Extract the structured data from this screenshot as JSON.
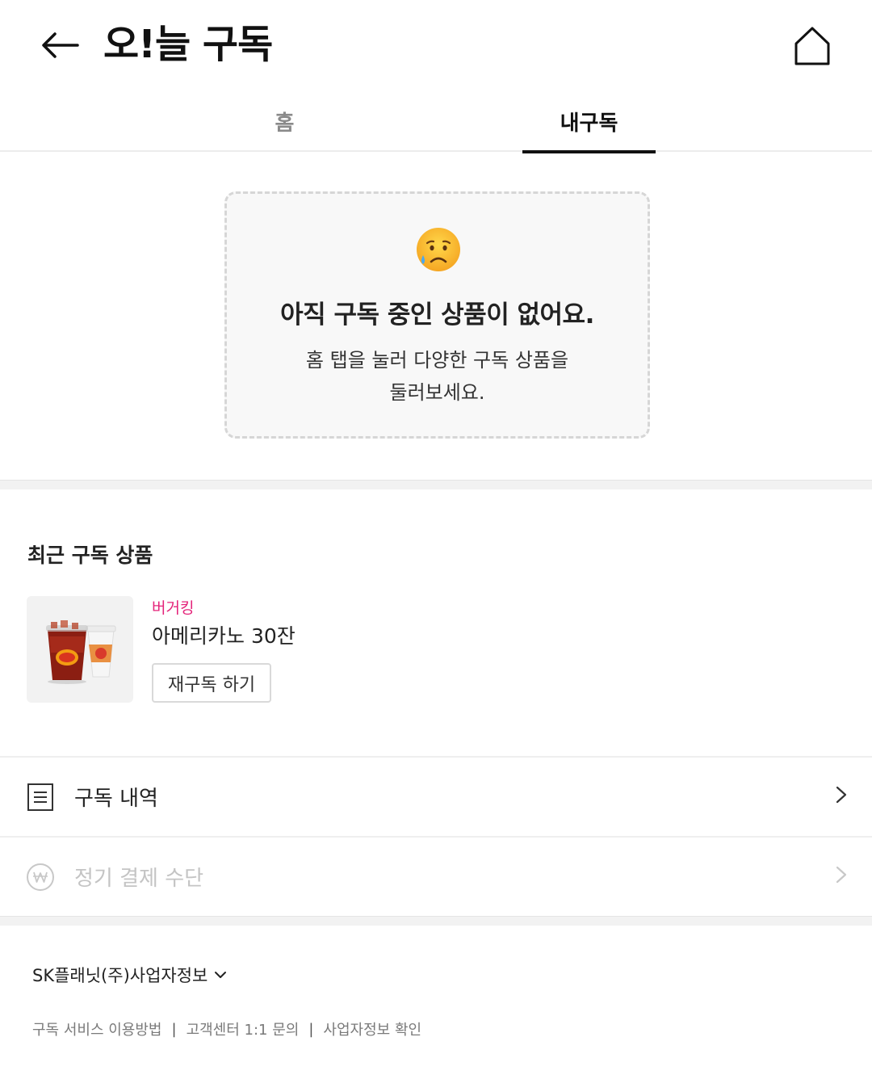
{
  "header": {
    "title": "오!늘 구독"
  },
  "tabs": [
    {
      "label": "홈",
      "active": false
    },
    {
      "label": "내구독",
      "active": true
    }
  ],
  "empty_state": {
    "emoji": "sad-face-with-sweat",
    "title": "아직 구독 중인 상품이 없어요.",
    "desc_line1": "홈 탭을 눌러 다양한 구독 상품을",
    "desc_line2": "둘러보세요."
  },
  "recent": {
    "section_title": "최근 구독 상품",
    "items": [
      {
        "brand": "버거킹",
        "name": "아메리카노 30잔",
        "button_label": "재구독 하기"
      }
    ]
  },
  "menu": [
    {
      "label": "구독 내역",
      "icon": "document-list-icon",
      "enabled": true
    },
    {
      "label": "정기 결제 수단",
      "icon": "won-coin-icon",
      "enabled": false
    }
  ],
  "footer": {
    "biz_info_label": "SK플래닛(주)사업자정보",
    "links": [
      "구독 서비스 이용방법",
      "고객센터 1:1 문의",
      "사업자정보 확인"
    ]
  },
  "colors": {
    "brand_accent": "#e4237a",
    "tab_active": "#111111",
    "tab_inactive": "#8a8a8a"
  }
}
